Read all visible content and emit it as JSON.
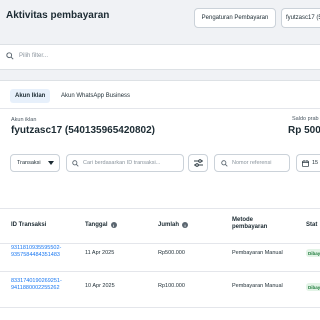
{
  "header": {
    "title": "Aktivitas pembayaran",
    "settings_button": "Pengaturan Pembayaran",
    "account_selector": "fyutzasc17 (5"
  },
  "filter_bar": {
    "placeholder": "Pilih filter..."
  },
  "tabs": [
    {
      "label": "Akun Iklan",
      "active": true
    },
    {
      "label": "Akun WhatsApp Business",
      "active": false
    }
  ],
  "account": {
    "label": "Akun iklan",
    "name": "fyutzasc17 (540135965420802)",
    "balance_label": "Saldo prab",
    "balance_value": "Rp 500"
  },
  "controls": {
    "transaction_type": "Transaksi",
    "search_placeholder": "Cari berdasarkan ID transaksi...",
    "reference_placeholder": "Nomor referensi",
    "date_partial": "15"
  },
  "table": {
    "columns": [
      {
        "label": "ID Transaksi",
        "info": false
      },
      {
        "label": "Tanggal",
        "info": true
      },
      {
        "label": "Jumlah",
        "info": true
      },
      {
        "label_line1": "Metode",
        "label_line2": "pembayaran",
        "info": false
      },
      {
        "label": "Stat",
        "info": false
      }
    ],
    "rows": [
      {
        "id_line1": "9311810935595502-",
        "id_line2": "9357584484351483",
        "date": "11 Apr 2025",
        "amount": "Rp500.000",
        "method": "Pembayaran Manual",
        "status": "Dibay"
      },
      {
        "id_line1": "8331740190269251-",
        "id_line2": "9411880002255262",
        "date": "10 Apr 2025",
        "amount": "Rp100.000",
        "method": "Pembayaran Manual",
        "status": "Dibay"
      }
    ]
  },
  "icons": {
    "search": "search-icon",
    "dropdown": "caret-down-icon",
    "filter": "filter-sliders-icon",
    "calendar": "calendar-icon",
    "info": "info-icon"
  },
  "colors": {
    "accent": "#1877f2",
    "tab_active_bg": "#e7f0fb",
    "status_bg": "#e2f3e6",
    "status_text": "#1d7a3a"
  }
}
